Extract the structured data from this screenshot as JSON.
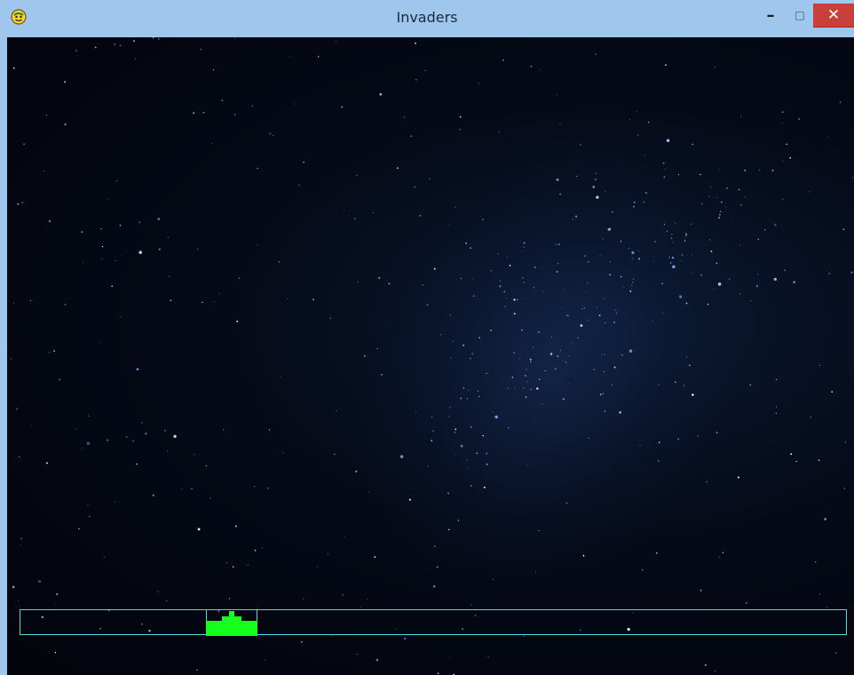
{
  "window": {
    "title": "Invaders",
    "app_icon": "pygame-snake-icon",
    "controls": {
      "minimize": "minimize-icon",
      "maximize": "maximize-icon",
      "close": "close-icon"
    }
  },
  "game": {
    "background": "starfield",
    "player_color": "#16ff1c",
    "lane_color": "#4fd8de"
  }
}
